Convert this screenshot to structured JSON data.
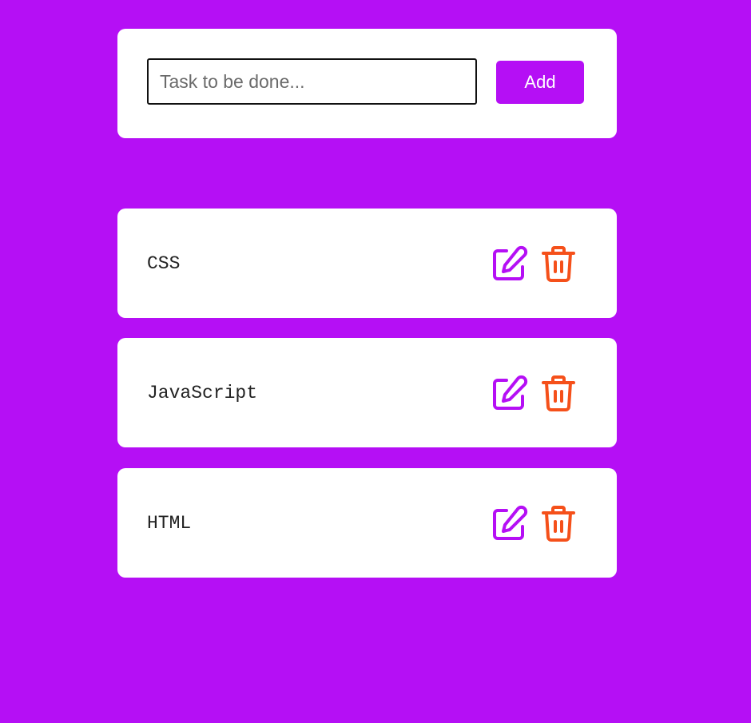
{
  "form": {
    "input_placeholder": "Task to be done...",
    "input_value": "",
    "add_label": "Add"
  },
  "tasks": [
    {
      "text": "CSS"
    },
    {
      "text": "JavaScript"
    },
    {
      "text": "HTML"
    }
  ],
  "icons": {
    "edit": "edit-icon",
    "delete": "trash-icon"
  },
  "colors": {
    "background": "#b50ff5",
    "accent": "#b50ff5",
    "delete": "#f5501a",
    "card": "#ffffff"
  }
}
